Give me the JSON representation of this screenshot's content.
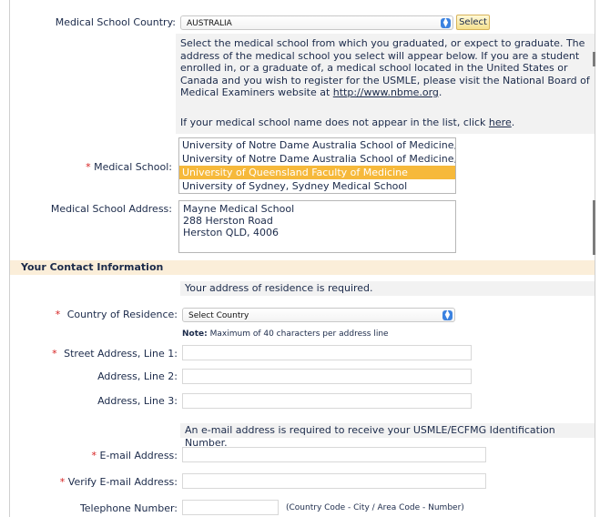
{
  "school_country": {
    "label": "Medical School Country:",
    "value": "AUSTRALIA",
    "select_button": "Select",
    "help_text_1": "Select the medical school from which you graduated, or expect to graduate. The address of the medical school you select will appear below. If you are a student enrolled in, or a graduate of, a medical school located in the United States or Canada and you wish to register for the USMLE, please visit the National Board of Medical Examiners website at",
    "help_link": "http://www.nbme.org",
    "help_text_2_prefix": "If your medical school name does not appear in the list, click",
    "help_text_2_link": "here"
  },
  "medical_school": {
    "label": "Medical School:",
    "required_mark": "*",
    "options": [
      "University of Notre Dame Australia School of Medicine, Fr",
      "University of Notre Dame Australia School of Medicine, Sy",
      "University of Queensland Faculty of Medicine",
      "University of Sydney, Sydney Medical School"
    ],
    "selected_index": 2
  },
  "school_address": {
    "label": "Medical School Address:",
    "lines": [
      "Mayne Medical School",
      "288 Herston Road",
      "Herston QLD, 4006"
    ]
  },
  "contact": {
    "section_title": "Your Contact Information",
    "residence_note": "Your address of residence is required.",
    "country_label": "Country of Residence:",
    "country_value": "Select Country",
    "max_note_bold": "Note:",
    "max_note": "Maximum of 40 characters per address line",
    "street1_label": "Street Address, Line 1:",
    "street2_label": "Address, Line 2:",
    "street3_label": "Address, Line 3:",
    "email_note": "An e-mail address is required to receive your USMLE/ECFMG Identification Number.",
    "email_label": "E-mail Address:",
    "verify_email_label": "Verify E-mail Address:",
    "phone_label": "Telephone Number:",
    "phone_hint": "(Country Code - City / Area Code - Number)",
    "required_mark": "*"
  },
  "colors": {
    "section_bg": "#fbeed9",
    "selected_option": "#f6b93b",
    "label_text": "#1b2a4a",
    "required": "#d62020"
  }
}
